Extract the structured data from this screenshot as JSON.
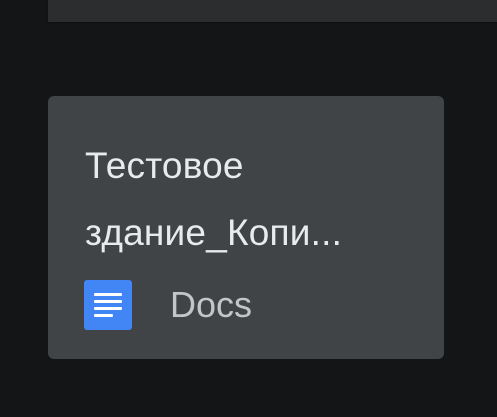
{
  "file_card": {
    "title_line_1": "Тестовое",
    "title_line_2": "здание_Копи...",
    "app_label": "Docs",
    "app_icon": "google-docs-icon"
  },
  "colors": {
    "background": "#141516",
    "card": "#404447",
    "title_text": "#e9eaec",
    "label_text": "#c3c6c9",
    "docs_icon": "#4285f4"
  }
}
